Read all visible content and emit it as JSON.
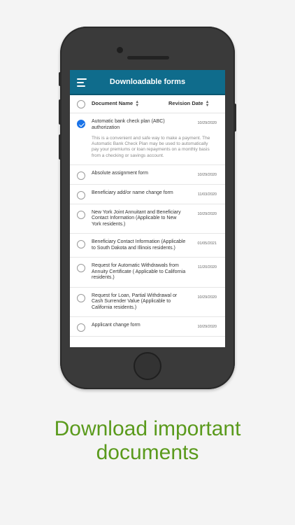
{
  "header": {
    "title": "Downloadable forms"
  },
  "columns": {
    "name": "Document Name",
    "date": "Revision Date"
  },
  "rows": [
    {
      "title": "Automatic bank check plan (ABC) authorization",
      "date": "10/29/2020",
      "description": "This is a convenient and safe way to make a payment. The Automatic Bank Check Plan may be used to automatically pay your premiums or loan repayments on a monthly basis from a checking or savings account.",
      "selected": true
    },
    {
      "title": "Absolute assignment form",
      "date": "10/29/2020"
    },
    {
      "title": "Beneficiary add/or name change form",
      "date": "11/03/2020"
    },
    {
      "title": "New York Joint Annuitant and Beneficiary Contact Information (Applicable to New York residents.)",
      "date": "10/29/2020"
    },
    {
      "title": "Beneficiary Contact Information (Applicable to South Dakota and Illinois residents.)",
      "date": "01/05/2021"
    },
    {
      "title": "Request for Automatic Withdrawals from Annuity Certificate ( Applicable to California residents.)",
      "date": "11/20/2020"
    },
    {
      "title": "Request for Loan, Partial Withdrawal or Cash Surrender Value (Applicable to California residents.)",
      "date": "10/29/2020"
    },
    {
      "title": "Applicant change form",
      "date": "10/29/2020"
    }
  ],
  "caption": {
    "line1": "Download important",
    "line2": "documents"
  },
  "colors": {
    "header_bg": "#0f6c8c",
    "check_blue": "#1a73e8",
    "caption_green": "#5a9a1c"
  }
}
